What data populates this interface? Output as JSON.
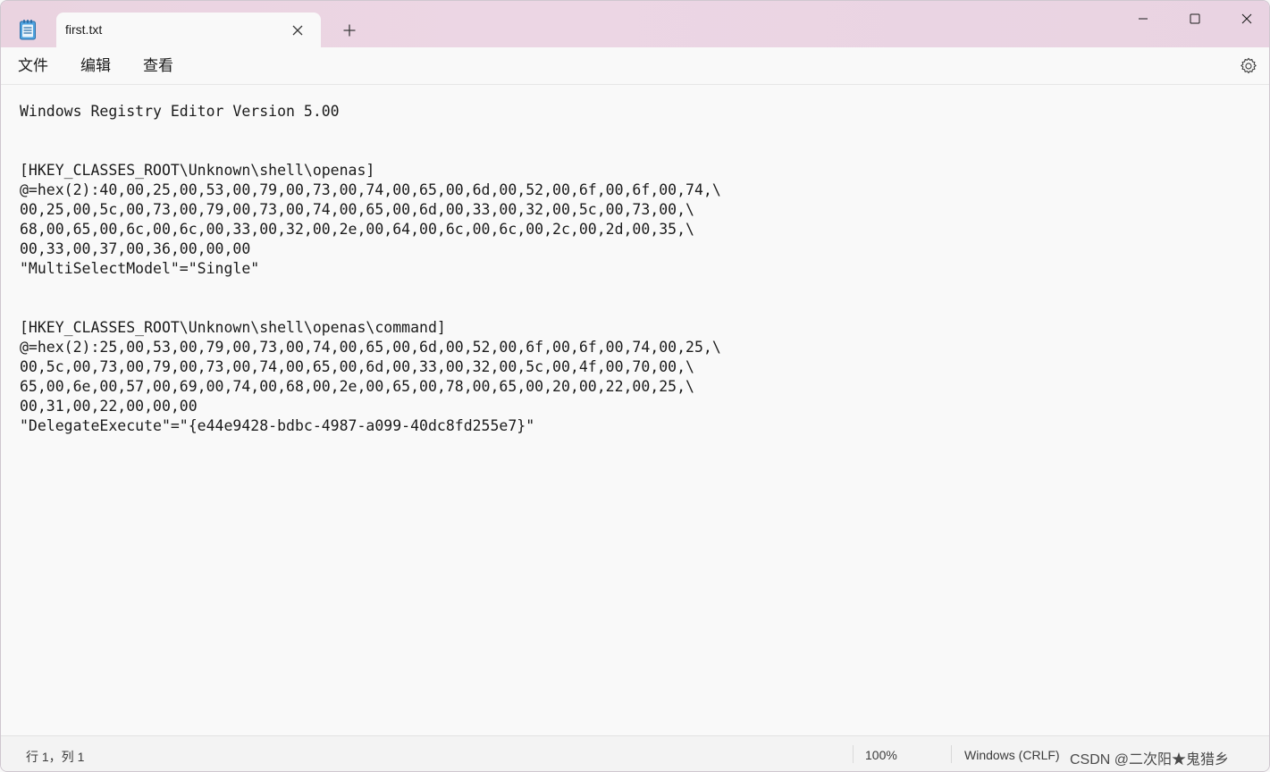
{
  "window": {
    "tab_title": "first.txt",
    "icons": {
      "app": "notepad-icon",
      "tab_close": "close-icon",
      "new_tab": "plus-icon",
      "minimize": "minimize-icon",
      "maximize": "maximize-icon",
      "close": "close-icon",
      "settings": "gear-icon"
    }
  },
  "menu": {
    "file": "文件",
    "edit": "编辑",
    "view": "查看"
  },
  "editor": {
    "lines": [
      "Windows Registry Editor Version 5.00",
      "",
      "",
      "[HKEY_CLASSES_ROOT\\Unknown\\shell\\openas]",
      "@=hex(2):40,00,25,00,53,00,79,00,73,00,74,00,65,00,6d,00,52,00,6f,00,6f,00,74,\\",
      "00,25,00,5c,00,73,00,79,00,73,00,74,00,65,00,6d,00,33,00,32,00,5c,00,73,00,\\",
      "68,00,65,00,6c,00,6c,00,33,00,32,00,2e,00,64,00,6c,00,6c,00,2c,00,2d,00,35,\\",
      "00,33,00,37,00,36,00,00,00",
      "\"MultiSelectModel\"=\"Single\"",
      "",
      "",
      "[HKEY_CLASSES_ROOT\\Unknown\\shell\\openas\\command]",
      "@=hex(2):25,00,53,00,79,00,73,00,74,00,65,00,6d,00,52,00,6f,00,6f,00,74,00,25,\\",
      "00,5c,00,73,00,79,00,73,00,74,00,65,00,6d,00,33,00,32,00,5c,00,4f,00,70,00,\\",
      "65,00,6e,00,57,00,69,00,74,00,68,00,2e,00,65,00,78,00,65,00,20,00,22,00,25,\\",
      "00,31,00,22,00,00,00",
      "\"DelegateExecute\"=\"{e44e9428-bdbc-4987-a099-40dc8fd255e7}\""
    ]
  },
  "status": {
    "position": "行 1，列 1",
    "zoom": "100%",
    "line_ending": "Windows (CRLF)",
    "encoding_overlay": "CSDN @二次阳★鬼猎乡"
  },
  "colors": {
    "titlebar": "#ead3e0",
    "editor_bg": "#f9f9f9",
    "text": "#1b1b1b",
    "statusbar": "#f3f3f3"
  }
}
